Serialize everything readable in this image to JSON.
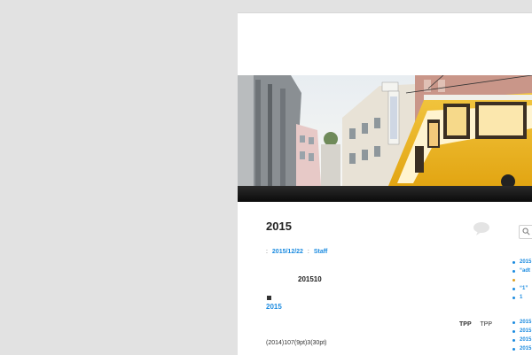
{
  "post": {
    "title": "2015",
    "date": "2015/12/22",
    "sep_before": ":",
    "sep_after": ":",
    "author": "Staff",
    "month_text": "201510",
    "year_link": "2015",
    "tpp_bold": "TPP",
    "tpp_plain": "TPP",
    "body_line": "(2014)107(9pt)3(30pt)"
  },
  "sidebar": {
    "recent": [
      "2015",
      "“adt",
      "",
      "“1”",
      "1"
    ],
    "archives": [
      "2015",
      "2015",
      "2015",
      "2015",
      "2015"
    ]
  },
  "colors": {
    "link": "#1b8be0",
    "page_bg": "#e2e2e2",
    "nav_bar": "#111111"
  }
}
